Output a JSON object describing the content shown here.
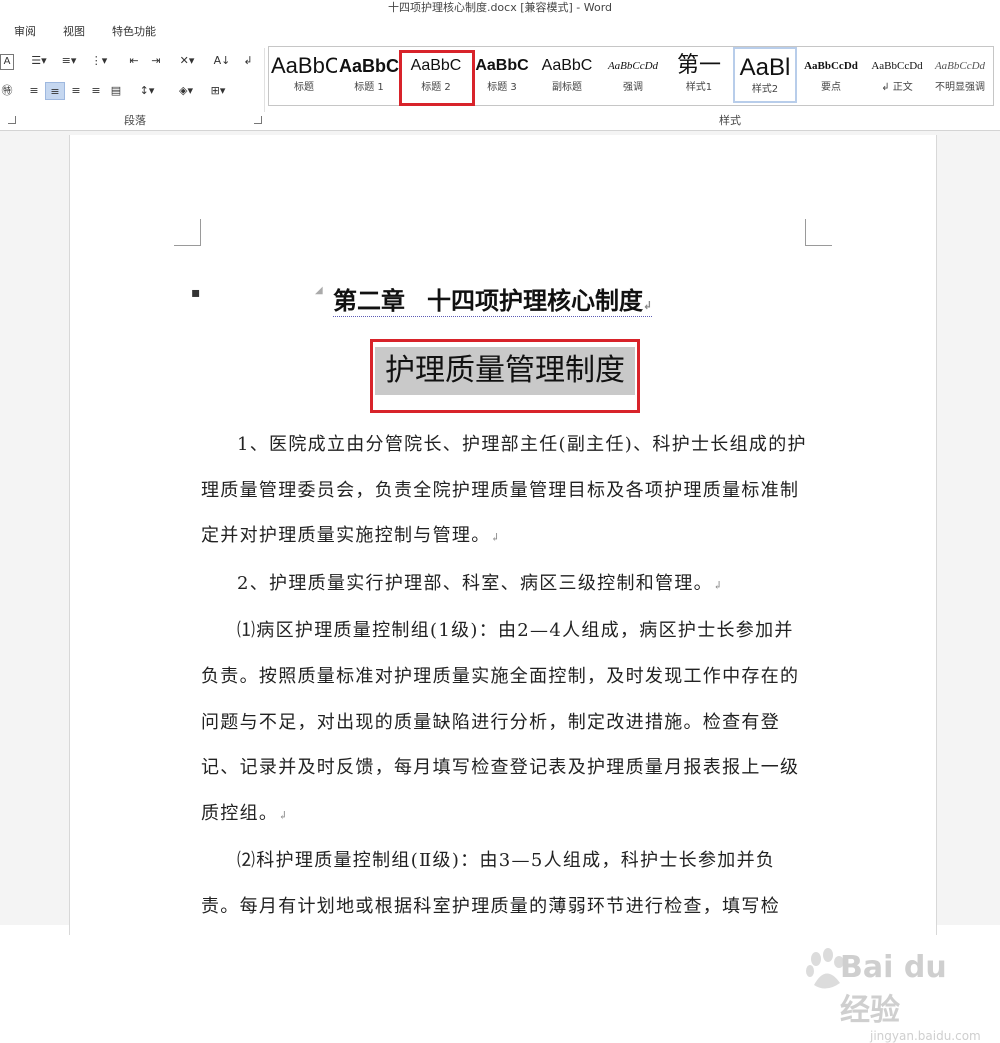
{
  "window": {
    "title": "十四项护理核心制度.docx [兼容模式] - Word"
  },
  "tabs": [
    "审阅",
    "视图",
    "特色功能"
  ],
  "ribbon": {
    "paragraph_group_label": "段落",
    "styles_group_label": "样式",
    "styles": [
      {
        "preview": "AaBbC",
        "name": "标题"
      },
      {
        "preview": "AaBbC",
        "name": "标题 1"
      },
      {
        "preview": "AaBbC",
        "name": "标题 2"
      },
      {
        "preview": "AaBbC",
        "name": "标题 3"
      },
      {
        "preview": "AaBbC",
        "name": "副标题"
      },
      {
        "preview": "AaBbCcDd",
        "name": "强调"
      },
      {
        "preview": "第一",
        "name": "样式1"
      },
      {
        "preview": "AaBl",
        "name": "样式2"
      },
      {
        "preview": "AaBbCcDd",
        "name": "要点"
      },
      {
        "preview": "AaBbCcDd",
        "name": "↲ 正文"
      },
      {
        "preview": "AaBbCcDd",
        "name": "不明显强调"
      }
    ]
  },
  "document": {
    "chapter_number": "第二章",
    "chapter_title": "十四项护理核心制度",
    "section_heading": "护理质量管理制度",
    "paragraphs": [
      "1、医院成立由分管院长、护理部主任(副主任)、科护士长组成的护理质量管理委员会，负责全院护理质量管理目标及各项护理质量标准制定并对护理质量实施控制与管理。",
      "2、护理质量实行护理部、科室、病区三级控制和管理。",
      "⑴病区护理质量控制组(1级)：由2—4人组成，病区护士长参加并负责。按照质量标准对护理质量实施全面控制，及时发现工作中存在的问题与不足，对出现的质量缺陷进行分析，制定改进措施。检查有登记、记录并及时反馈，每月填写检查登记表及护理质量月报表报上一级质控组。",
      "⑵科护理质量控制组(Ⅱ级)：由3—5人组成，科护士长参加并负责。每月有计划地或根据科室护理质量的薄弱环节进行检查，填写检"
    ]
  },
  "watermark": {
    "brand": "Bai du 经验",
    "url": "jingyan.baidu.com"
  }
}
